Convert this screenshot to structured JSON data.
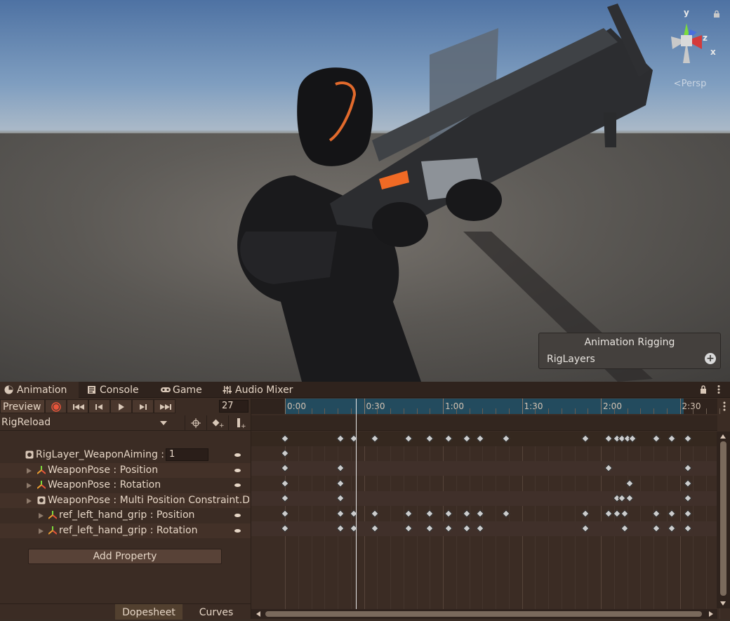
{
  "scene": {
    "gizmo": {
      "axis_x": "x",
      "axis_y": "y",
      "axis_z": "z",
      "projection": "Persp"
    },
    "rigging_panel": {
      "title": "Animation Rigging",
      "item": "RigLayers"
    }
  },
  "tabs": [
    {
      "label": "Animation",
      "icon": "clock-icon"
    },
    {
      "label": "Console",
      "icon": "console-icon"
    },
    {
      "label": "Game",
      "icon": "gamepad-icon"
    },
    {
      "label": "Audio Mixer",
      "icon": "mixer-icon"
    }
  ],
  "toolbar": {
    "preview_label": "Preview",
    "frame": "27",
    "clip_name": "RigReload"
  },
  "properties": [
    {
      "label": "RigLayer_WeaponAiming : R",
      "value": "1",
      "icon": "component-icon"
    },
    {
      "label": "WeaponPose : Position",
      "icon": "transform-icon"
    },
    {
      "label": "WeaponPose : Rotation",
      "icon": "transform-icon"
    },
    {
      "label": "WeaponPose : Multi Position Constraint.Dat",
      "icon": "component-icon"
    },
    {
      "label": "ref_left_hand_grip : Position",
      "icon": "transform-icon"
    },
    {
      "label": "ref_left_hand_grip : Rotation",
      "icon": "transform-icon"
    }
  ],
  "add_property_label": "Add Property",
  "view_tabs": {
    "dopesheet": "Dopesheet",
    "curves": "Curves"
  },
  "timeline": {
    "labels": [
      "0:00",
      "0:30",
      "1:00",
      "1:30",
      "2:00",
      "2:30"
    ],
    "playhead_frame": 27,
    "keyframes": {
      "summary": [
        0,
        21,
        26,
        34,
        47,
        55,
        62,
        69,
        74,
        84,
        114,
        123,
        126,
        128,
        130,
        132,
        141,
        147,
        153
      ],
      "row1": [
        0
      ],
      "row2": [
        0,
        21,
        123,
        153
      ],
      "row3": [
        0,
        21,
        131,
        153
      ],
      "row4": [
        0,
        21,
        126,
        128,
        131,
        153
      ],
      "row5": [
        0,
        21,
        26,
        34,
        47,
        55,
        62,
        69,
        74,
        84,
        114,
        123,
        126,
        129,
        141,
        147,
        153
      ],
      "row6": [
        0,
        21,
        26,
        34,
        47,
        55,
        62,
        69,
        74,
        114,
        129,
        141,
        147,
        153
      ]
    }
  },
  "colors": {
    "window_bg": "#3b2c24",
    "timeline_range": "#234b5e",
    "record": "#e8553b",
    "key": "#cdcdcd"
  }
}
